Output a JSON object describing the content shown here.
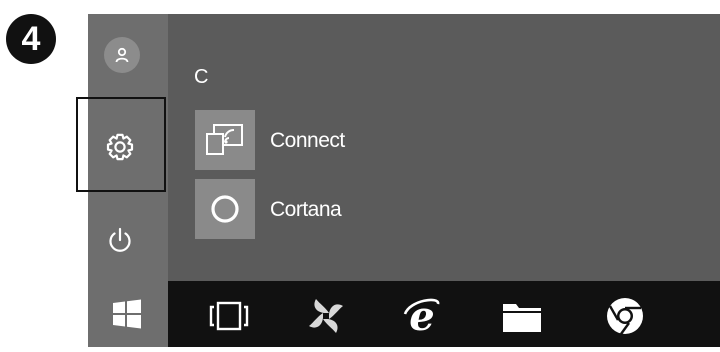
{
  "step_number": "4",
  "sidebar": {
    "items": [
      {
        "name": "user-account",
        "icon": "user-icon"
      },
      {
        "name": "settings",
        "icon": "gear-icon",
        "highlighted": true
      },
      {
        "name": "power",
        "icon": "power-icon"
      }
    ]
  },
  "app_list": {
    "section_letter": "C",
    "apps": [
      {
        "label": "Connect",
        "icon": "cast-icon"
      },
      {
        "label": "Cortana",
        "icon": "cortana-circle-icon"
      }
    ]
  },
  "taskbar": {
    "items": [
      {
        "name": "start",
        "icon": "windows-logo-icon"
      },
      {
        "name": "task-view",
        "icon": "task-view-icon"
      },
      {
        "name": "app-pinwheel",
        "icon": "pinwheel-icon"
      },
      {
        "name": "internet-explorer",
        "icon": "ie-icon"
      },
      {
        "name": "file-explorer",
        "icon": "folder-icon"
      },
      {
        "name": "chrome",
        "icon": "chrome-icon"
      }
    ]
  },
  "colors": {
    "rail": "#6e6e6e",
    "panel": "#5b5b5b",
    "taskbar": "#111111",
    "tile": "#8a8a8a"
  }
}
